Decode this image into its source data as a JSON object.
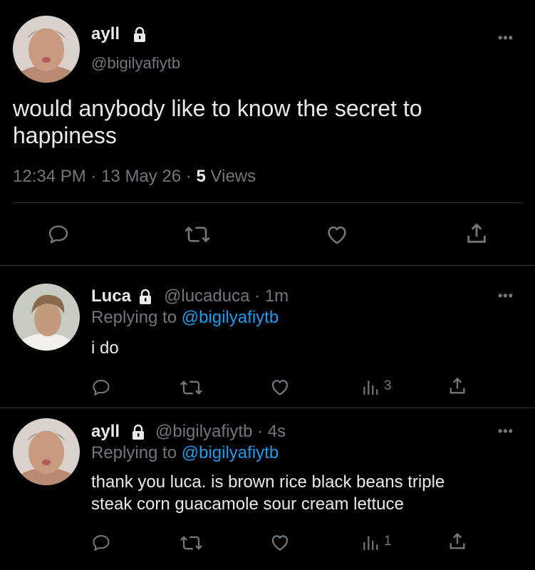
{
  "main_tweet": {
    "display_name": "ayll",
    "handle": "@bigilyafiytb",
    "text_line1": "would anybody like to know the secret to",
    "text_line2": "happiness",
    "time": "12:34 PM",
    "date": "13 May 26",
    "sep": "·",
    "views_count": "5",
    "views_label": "Views"
  },
  "reply1": {
    "display_name": "Luca",
    "handle": "@lucaduca",
    "age": "· 1m",
    "replying_prefix": "Replying to",
    "replying_handle": "@bigilyafiytb",
    "text": "i do",
    "views": "3"
  },
  "reply2": {
    "display_name": "ayll",
    "handle": "@bigilyafiytb",
    "age": "· 4s",
    "replying_prefix": "Replying to",
    "replying_handle": "@bigilyafiytb",
    "text_line1": "thank you luca. is brown rice black beans triple",
    "text_line2": "steak corn guacamole sour cream lettuce",
    "views": "1"
  },
  "more_glyph": "•••",
  "colors": {
    "background": "#000000",
    "text": "#e7e9ea",
    "muted": "#71767b",
    "link": "#1d9bf0",
    "divider": "#2f3336"
  },
  "icons": [
    "lock-icon",
    "reply-icon",
    "retweet-icon",
    "like-icon",
    "share-icon",
    "views-icon",
    "more-icon"
  ]
}
